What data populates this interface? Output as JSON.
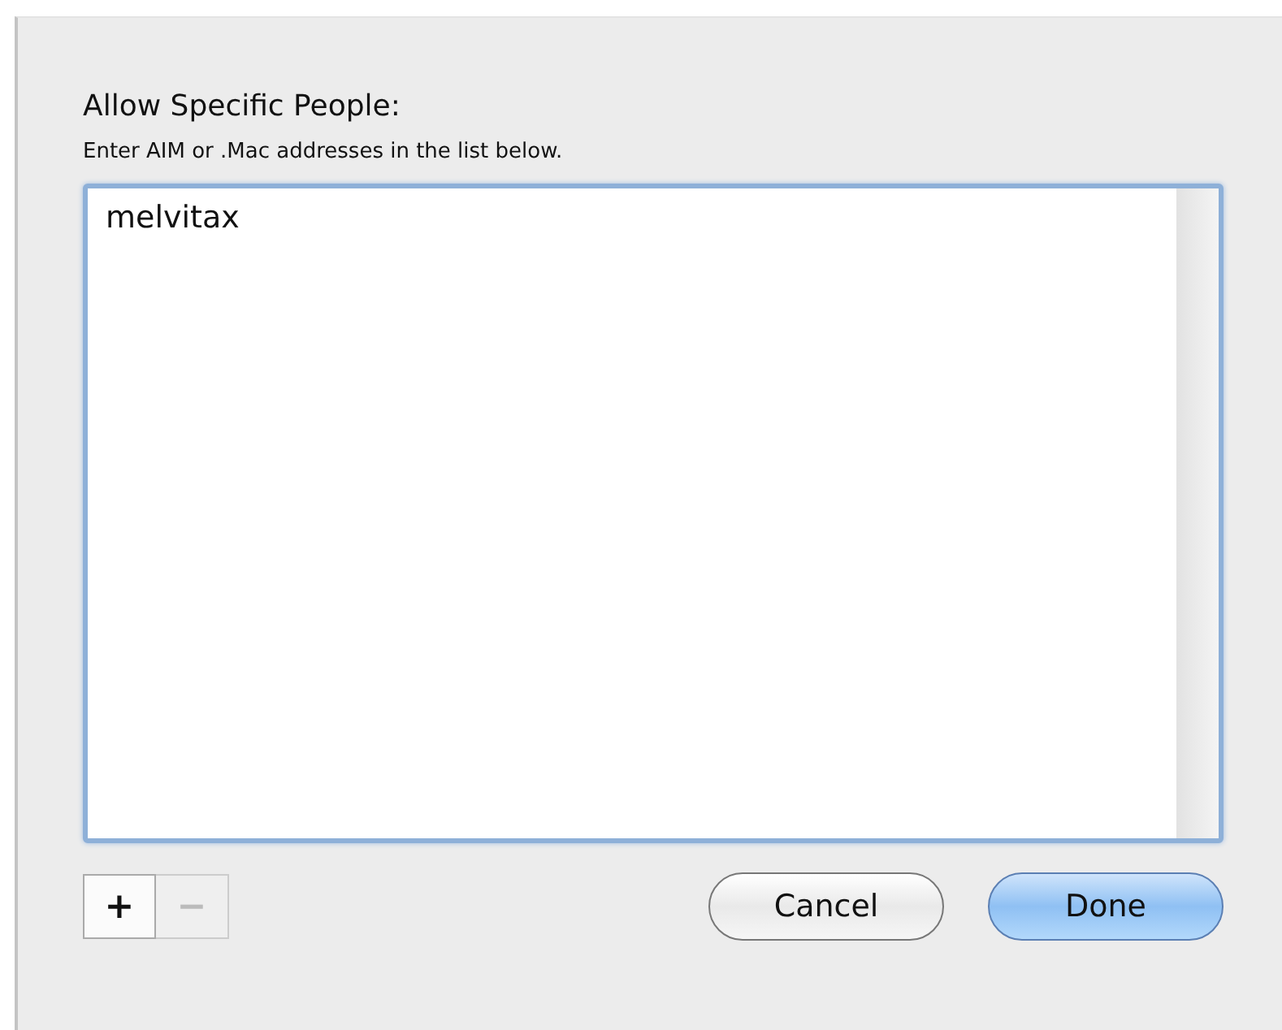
{
  "heading": "Allow Specific People:",
  "instructions": "Enter AIM or .Mac addresses in the list below.",
  "addresses": [
    {
      "text": "melvitax",
      "selected": false
    }
  ],
  "list_buttons": [
    {
      "label": "+",
      "disabled": false
    },
    {
      "label": "−",
      "disabled": true
    }
  ],
  "buttons": [
    {
      "label": "Cancel",
      "kind": "normal"
    },
    {
      "label": "Done",
      "kind": "default"
    }
  ]
}
